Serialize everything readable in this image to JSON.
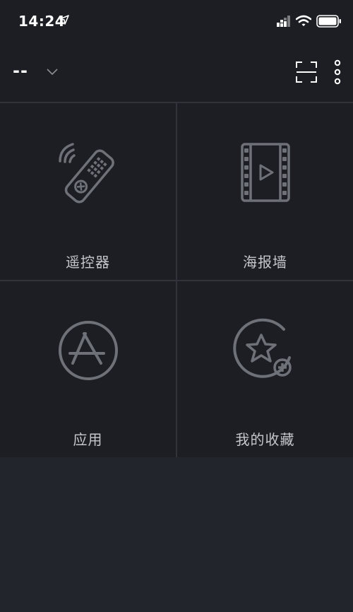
{
  "status_bar": {
    "time": "14:24",
    "icons": [
      "location-arrow-icon",
      "signal-icon",
      "wifi-icon",
      "battery-icon"
    ]
  },
  "header": {
    "device_name": "--",
    "icons": [
      "chevron-down-icon",
      "scan-icon",
      "more-icon"
    ]
  },
  "tiles": [
    {
      "label": "遥控器",
      "icon": "remote-control-icon"
    },
    {
      "label": "海报墙",
      "icon": "film-play-icon"
    },
    {
      "label": "应用",
      "icon": "app-store-icon"
    },
    {
      "label": "我的收藏",
      "icon": "favorites-star-add-icon"
    }
  ],
  "colors": {
    "background": "#22252c",
    "tile": "#1c1e24",
    "divider": "#30333a",
    "icon": "#6e7178",
    "label": "#c5c7cb"
  }
}
